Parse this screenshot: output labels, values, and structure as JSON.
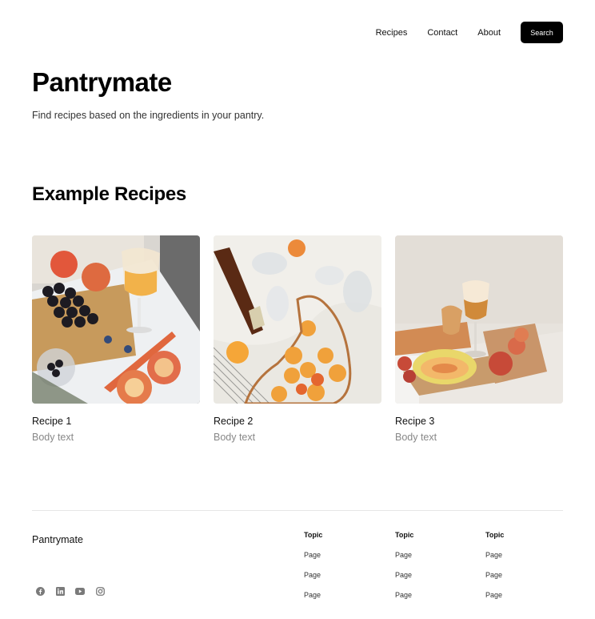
{
  "nav": {
    "links": [
      "Recipes",
      "Contact",
      "About"
    ],
    "search_label": "Search"
  },
  "hero": {
    "title": "Pantrymate",
    "subtitle": "Find recipes based on the ingredients in your pantry."
  },
  "section": {
    "title": "Example Recipes"
  },
  "cards": [
    {
      "title": "Recipe 1",
      "body": "Body text"
    },
    {
      "title": "Recipe 2",
      "body": "Body text"
    },
    {
      "title": "Recipe 3",
      "body": "Body text"
    }
  ],
  "footer": {
    "brand": "Pantrymate",
    "socials": [
      "facebook-icon",
      "linkedin-icon",
      "youtube-icon",
      "instagram-icon"
    ],
    "columns": [
      {
        "topic": "Topic",
        "pages": [
          "Page",
          "Page",
          "Page"
        ]
      },
      {
        "topic": "Topic",
        "pages": [
          "Page",
          "Page",
          "Page"
        ]
      },
      {
        "topic": "Topic",
        "pages": [
          "Page",
          "Page",
          "Page"
        ]
      }
    ]
  },
  "colors": {
    "primary": "#000000",
    "muted_text": "#888888",
    "divider": "#e6e6e6"
  }
}
